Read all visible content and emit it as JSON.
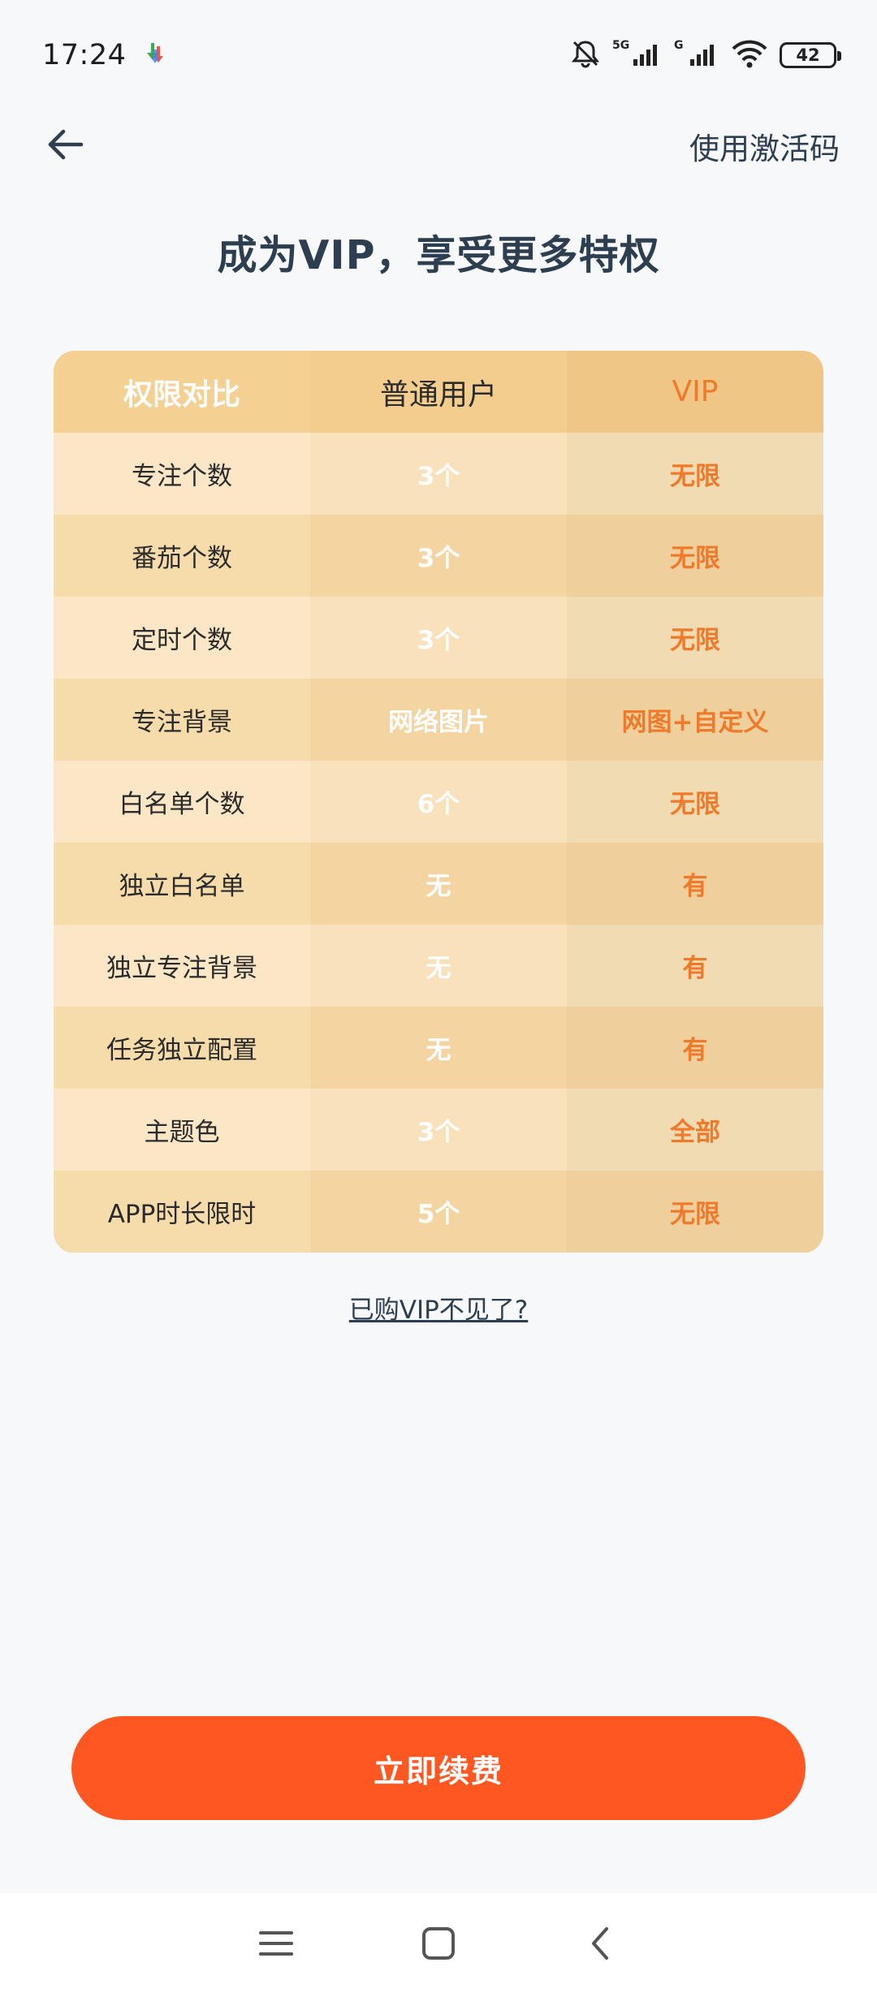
{
  "status_bar": {
    "time": "17:24",
    "battery": "42",
    "icons": [
      "download-arrows-icon",
      "bell-muted-icon",
      "signal-5g-icon",
      "signal-g-icon",
      "wifi-icon",
      "battery-icon"
    ]
  },
  "header": {
    "back_icon": "arrow-left-icon",
    "activation_label": "使用激活码"
  },
  "title": "成为VIP，享受更多特权",
  "table": {
    "headers": {
      "feature": "权限对比",
      "normal": "普通用户",
      "vip": "VIP"
    },
    "rows": [
      {
        "feature": "专注个数",
        "normal": "3个",
        "vip": "无限"
      },
      {
        "feature": "番茄个数",
        "normal": "3个",
        "vip": "无限"
      },
      {
        "feature": "定时个数",
        "normal": "3个",
        "vip": "无限"
      },
      {
        "feature": "专注背景",
        "normal": "网络图片",
        "vip": "网图+自定义"
      },
      {
        "feature": "白名单个数",
        "normal": "6个",
        "vip": "无限"
      },
      {
        "feature": "独立白名单",
        "normal": "无",
        "vip": "有"
      },
      {
        "feature": "独立专注背景",
        "normal": "无",
        "vip": "有"
      },
      {
        "feature": "任务独立配置",
        "normal": "无",
        "vip": "有"
      },
      {
        "feature": "主题色",
        "normal": "3个",
        "vip": "全部"
      },
      {
        "feature": "APP时长限时",
        "normal": "5个",
        "vip": "无限"
      }
    ]
  },
  "lost_vip_link": "已购VIP不见了?",
  "renew_button": "立即续费",
  "colors": {
    "accent": "#ff5722",
    "vip_text": "#f07a2b",
    "background": "#f7f8fa"
  },
  "nav_bar": {
    "icons": [
      "menu-icon",
      "home-square-icon",
      "back-chevron-icon"
    ]
  }
}
